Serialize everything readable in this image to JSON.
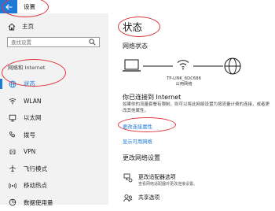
{
  "window": {
    "title": "设置"
  },
  "sidebar": {
    "home_label": "主页",
    "search_placeholder": "查找设置",
    "section_title": "网络和 Internet",
    "items": [
      {
        "label": "状态",
        "icon": "globe-icon",
        "active": true
      },
      {
        "label": "WLAN",
        "icon": "wifi-icon"
      },
      {
        "label": "以太网",
        "icon": "ethernet-icon"
      },
      {
        "label": "拨号",
        "icon": "dialup-icon"
      },
      {
        "label": "VPN",
        "icon": "vpn-icon"
      },
      {
        "label": "飞行模式",
        "icon": "airplane-icon"
      },
      {
        "label": "移动热点",
        "icon": "hotspot-icon"
      },
      {
        "label": "数据使用量",
        "icon": "data-usage-icon"
      }
    ]
  },
  "main": {
    "title": "状态",
    "network_status_heading": "网络状态",
    "network_name_line1": "TP-LINK_6DC686",
    "network_name_line2": "公用网络",
    "connected_title": "你已连接到 Internet",
    "connected_desc": "如果你的流量套餐有限制，则可以将此网络设置为按流量计费的连接，或者更改其他属性。",
    "change_connection_props_link": "更改连接属性",
    "show_available_networks_link": "显示可用网络",
    "change_network_settings_heading": "更改网络设置",
    "adapter_options_title": "更改适配器选项",
    "adapter_options_desc": "查看网络适配器并更改连接设置。",
    "sharing_options_title": "共享选项"
  },
  "colors": {
    "accent": "#1e79d7",
    "annotation": "#e0343c",
    "sidebar_bg": "#f2f2f2"
  }
}
